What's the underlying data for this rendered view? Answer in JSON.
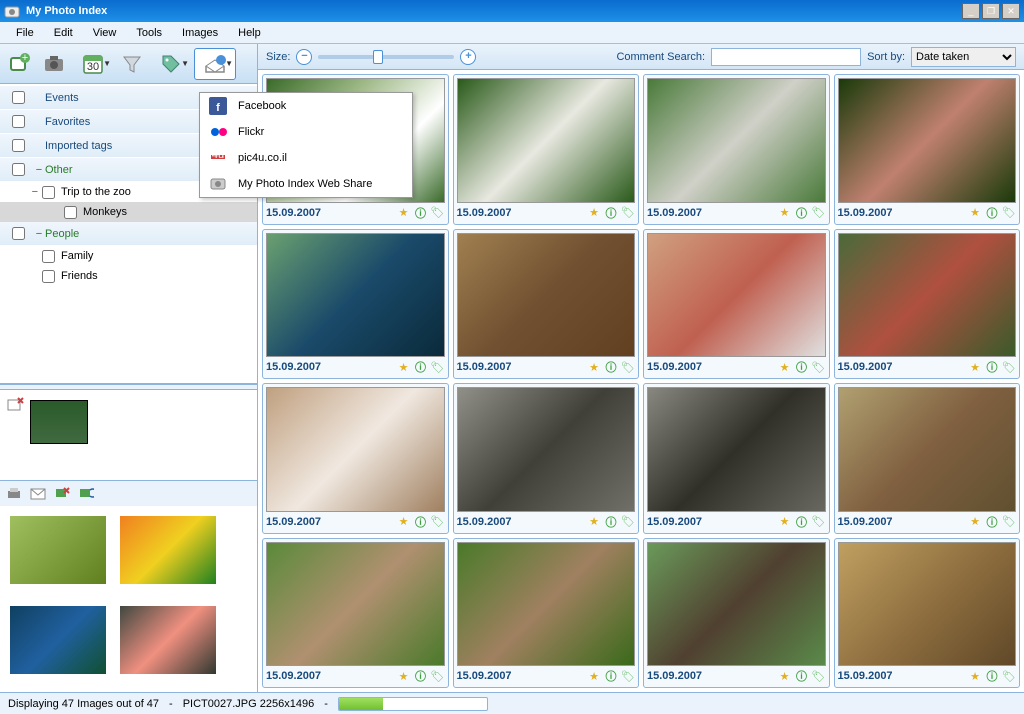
{
  "title": "My Photo Index",
  "menu": [
    "File",
    "Edit",
    "View",
    "Tools",
    "Images",
    "Help"
  ],
  "toolbar_buttons": [
    "add-photo",
    "camera",
    "calendar",
    "funnel",
    "tag",
    "share"
  ],
  "share_menu": [
    {
      "icon": "facebook",
      "label": "Facebook"
    },
    {
      "icon": "flickr",
      "label": "Flickr"
    },
    {
      "icon": "pic4u",
      "label": "pic4u.co.il"
    },
    {
      "icon": "webshare",
      "label": "My Photo Index Web Share"
    }
  ],
  "tags": [
    {
      "label": "Events",
      "exp": "",
      "indent": 0
    },
    {
      "label": "Favorites",
      "exp": "",
      "indent": 0
    },
    {
      "label": "Imported tags",
      "exp": "",
      "indent": 0
    },
    {
      "label": "Other",
      "exp": "−",
      "indent": 0,
      "color": "green"
    },
    {
      "label": "Trip to the zoo",
      "exp": "−",
      "indent": 1
    },
    {
      "label": "Monkeys",
      "exp": "",
      "indent": 2,
      "selected": true
    },
    {
      "label": "People",
      "exp": "−",
      "indent": 0,
      "color": "green"
    },
    {
      "label": "Family",
      "exp": "",
      "indent": 1
    },
    {
      "label": "Friends",
      "exp": "",
      "indent": 1
    }
  ],
  "topbar": {
    "size_label": "Size:",
    "search_label": "Comment Search:",
    "sort_label": "Sort by:",
    "sort_value": "Date taken"
  },
  "thumbnails": [
    {
      "date": "15.09.2007",
      "cls": "ph1"
    },
    {
      "date": "15.09.2007",
      "cls": "ph2"
    },
    {
      "date": "15.09.2007",
      "cls": "ph3"
    },
    {
      "date": "15.09.2007",
      "cls": "ph4"
    },
    {
      "date": "15.09.2007",
      "cls": "ph5"
    },
    {
      "date": "15.09.2007",
      "cls": "ph6"
    },
    {
      "date": "15.09.2007",
      "cls": "ph7"
    },
    {
      "date": "15.09.2007",
      "cls": "ph8"
    },
    {
      "date": "15.09.2007",
      "cls": "ph9"
    },
    {
      "date": "15.09.2007",
      "cls": "ph10"
    },
    {
      "date": "15.09.2007",
      "cls": "ph11"
    },
    {
      "date": "15.09.2007",
      "cls": "ph12"
    },
    {
      "date": "15.09.2007",
      "cls": "ph13"
    },
    {
      "date": "15.09.2007",
      "cls": "ph14"
    },
    {
      "date": "15.09.2007",
      "cls": "ph15"
    },
    {
      "date": "15.09.2007",
      "cls": "ph16"
    }
  ],
  "strip_thumbs": [
    "sp1",
    "sp2",
    "sp3",
    "sp4"
  ],
  "status": {
    "text": "Displaying 47 Images out of 47",
    "file": "PICT0027.JPG 2256x1496",
    "sep": "- "
  }
}
